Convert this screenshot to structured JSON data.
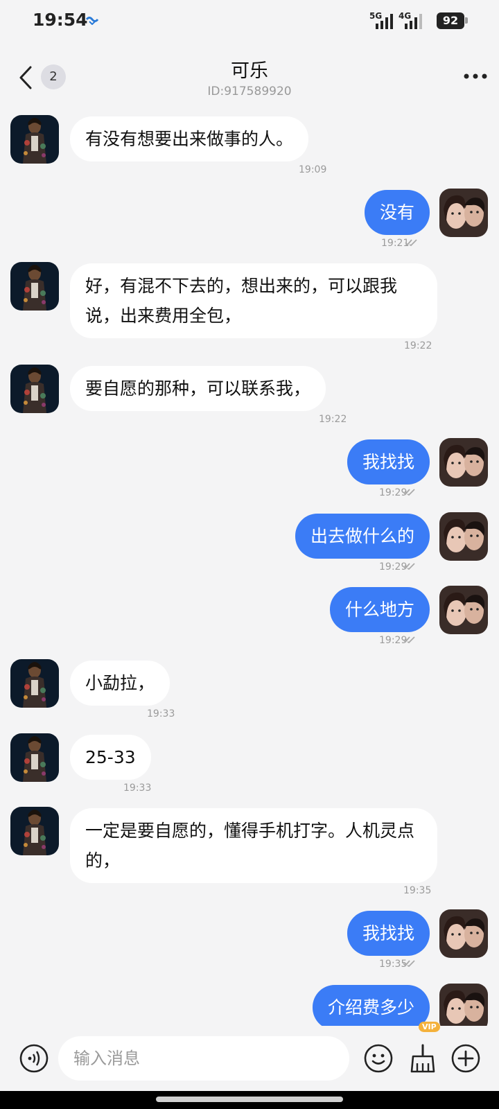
{
  "status_bar": {
    "time": "19:54",
    "net1": "5G",
    "net2": "4G",
    "battery": "92"
  },
  "header": {
    "name": "可乐",
    "id_text": "ID:917589920",
    "unread": "2"
  },
  "messages": [
    {
      "dir": "in",
      "text": "有没有想要出来做事的人。",
      "time": "19:09"
    },
    {
      "dir": "out",
      "text": "没有",
      "time": "19:21",
      "read": true
    },
    {
      "dir": "in",
      "text": "好，有混不下去的，想出来的，可以跟我说，出来费用全包，",
      "time": "19:22"
    },
    {
      "dir": "in",
      "text": "要自愿的那种，可以联系我，",
      "time": "19:22"
    },
    {
      "dir": "out",
      "text": "我找找",
      "time": "19:29",
      "read": true
    },
    {
      "dir": "out",
      "text": "出去做什么的",
      "time": "19:29",
      "read": true
    },
    {
      "dir": "out",
      "text": "什么地方",
      "time": "19:29",
      "read": true
    },
    {
      "dir": "in",
      "text": "小勐拉，",
      "time": "19:33"
    },
    {
      "dir": "in",
      "text": "25-33",
      "time": "19:33"
    },
    {
      "dir": "in",
      "text": "一定是要自愿的，懂得手机打字。人机灵点的，",
      "time": "19:35"
    },
    {
      "dir": "out",
      "text": "我找找",
      "time": "19:35",
      "read": true
    },
    {
      "dir": "out",
      "text": "介绍费多少",
      "time": "",
      "read": false
    }
  ],
  "input": {
    "placeholder": "输入消息",
    "vip_label": "VIP"
  },
  "colors": {
    "outgoing_bubble": "#3b7cf6",
    "incoming_bubble": "#ffffff",
    "background": "#f4f4f5"
  },
  "icons": [
    "back-icon",
    "more-icon",
    "voice-icon",
    "emoji-icon",
    "clean-icon",
    "plus-icon",
    "double-check-icon"
  ]
}
